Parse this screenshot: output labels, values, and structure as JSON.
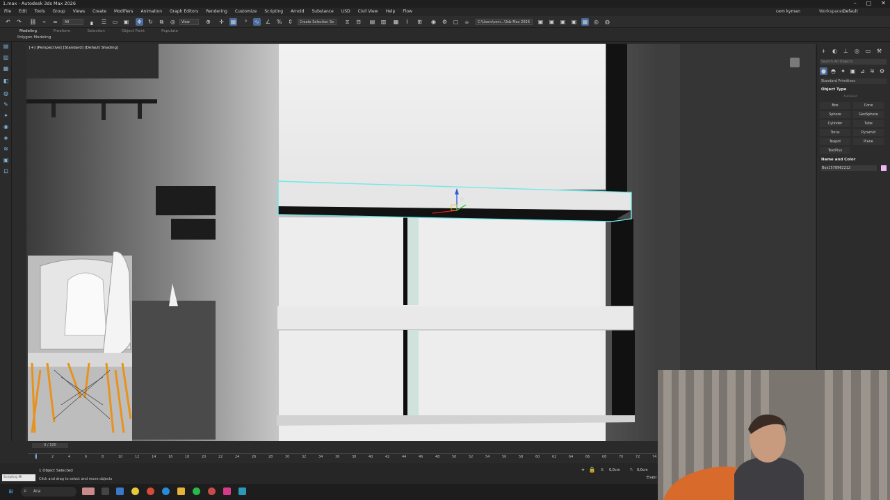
{
  "window": {
    "title": "1.max - Autodesk 3ds Max 2026",
    "controls": [
      "–",
      "□",
      "✕"
    ]
  },
  "menubar": {
    "items": [
      "File",
      "Edit",
      "Tools",
      "Group",
      "Views",
      "Create",
      "Modifiers",
      "Animation",
      "Graph Editors",
      "Rendering",
      "Customize",
      "Scripting",
      "Arnold",
      "Substance",
      "USD",
      "Civil View",
      "Help",
      "Flow"
    ],
    "user": "cem kyman",
    "workspace_label": "Workspaces:",
    "workspace_value": "Default"
  },
  "toolbar": {
    "filter": "All",
    "view": "View",
    "selection_set": "Create Selection Se",
    "path": "C:\\Users\\cem...\\3ds Max 2026"
  },
  "ribbon": {
    "tabs": [
      "Modeling",
      "Freeform",
      "Selection",
      "Object Paint",
      "Populate"
    ],
    "active_tab": "Modeling",
    "subpanel": "Polygon Modeling"
  },
  "viewport": {
    "label": "[+] [Perspective] [Standard] [Default Shading]"
  },
  "command_panel": {
    "search_placeholder": "Search All Objects",
    "category": "Standard Primitives",
    "object_type_header": "Object Type",
    "autogrid": "AutoGrid",
    "buttons": [
      "Box",
      "Cone",
      "Sphere",
      "GeoSphere",
      "Cylinder",
      "Tube",
      "Torus",
      "Pyramid",
      "Teapot",
      "Plane",
      "TextPlus"
    ],
    "name_color_header": "Name and Color",
    "object_name": "Box1578962212",
    "object_color": "#f0b8f0"
  },
  "timeline": {
    "frame_display": "0 / 100",
    "ticks": [
      "0",
      "2",
      "4",
      "6",
      "8",
      "10",
      "12",
      "14",
      "16",
      "18",
      "20",
      "22",
      "24",
      "26",
      "28",
      "30",
      "32",
      "34",
      "36",
      "38",
      "40",
      "42",
      "44",
      "46",
      "48",
      "50",
      "52",
      "54",
      "56",
      "58",
      "60",
      "62",
      "64",
      "66",
      "68",
      "70",
      "72",
      "74"
    ]
  },
  "status": {
    "selection": "1 Object Selected",
    "hint": "Click and drag to select and move objects",
    "script_box": "Scripting Mi",
    "coord_x": "0,0cm",
    "coord_y": "0,0cm",
    "enable": "Enabl"
  },
  "taskbar": {
    "search": "Ara"
  },
  "colors": {
    "selection_outline": "#6fe8e8",
    "chair_legs": "#e8921c",
    "active_tool": "#4b6b9a"
  }
}
